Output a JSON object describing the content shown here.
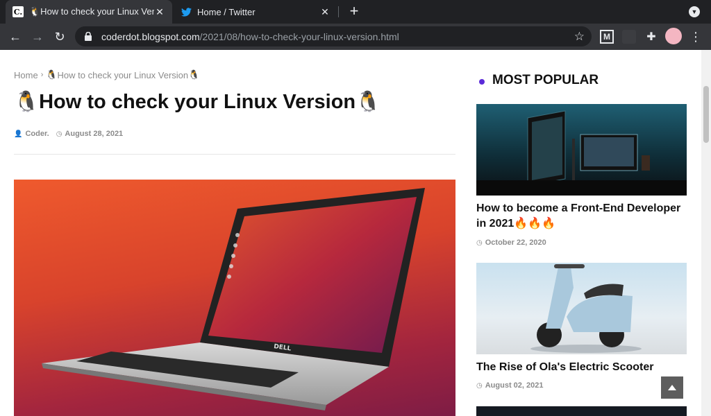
{
  "browser": {
    "tabs": [
      {
        "title": "🐧How to check your Linux Version🐧",
        "favicon": "C."
      },
      {
        "title": "Home / Twitter",
        "favicon": "twitter-bird"
      }
    ],
    "url_host": "coderdot.blogspot.com",
    "url_path": "/2021/08/how-to-check-your-linux-version.html",
    "extension_m": "M"
  },
  "article": {
    "breadcrumb_home": "Home",
    "breadcrumb_current": "How to check your Linux Version",
    "title": "How to check your Linux Version",
    "title_emoji": "🐧",
    "author": "Coder.",
    "date": "August 28, 2021",
    "laptop_brand": "DELL"
  },
  "sidebar": {
    "heading": "MOST POPULAR",
    "posts": [
      {
        "title": "How to become a Front-End Developer in 2021🔥🔥🔥",
        "date": "October 22, 2020"
      },
      {
        "title": "The Rise of Ola's Electric Scooter",
        "date": "August 02, 2021"
      }
    ]
  },
  "colors": {
    "accent": "#5b2bd8",
    "tab_bar": "#202124",
    "toolbar": "#35363a"
  }
}
